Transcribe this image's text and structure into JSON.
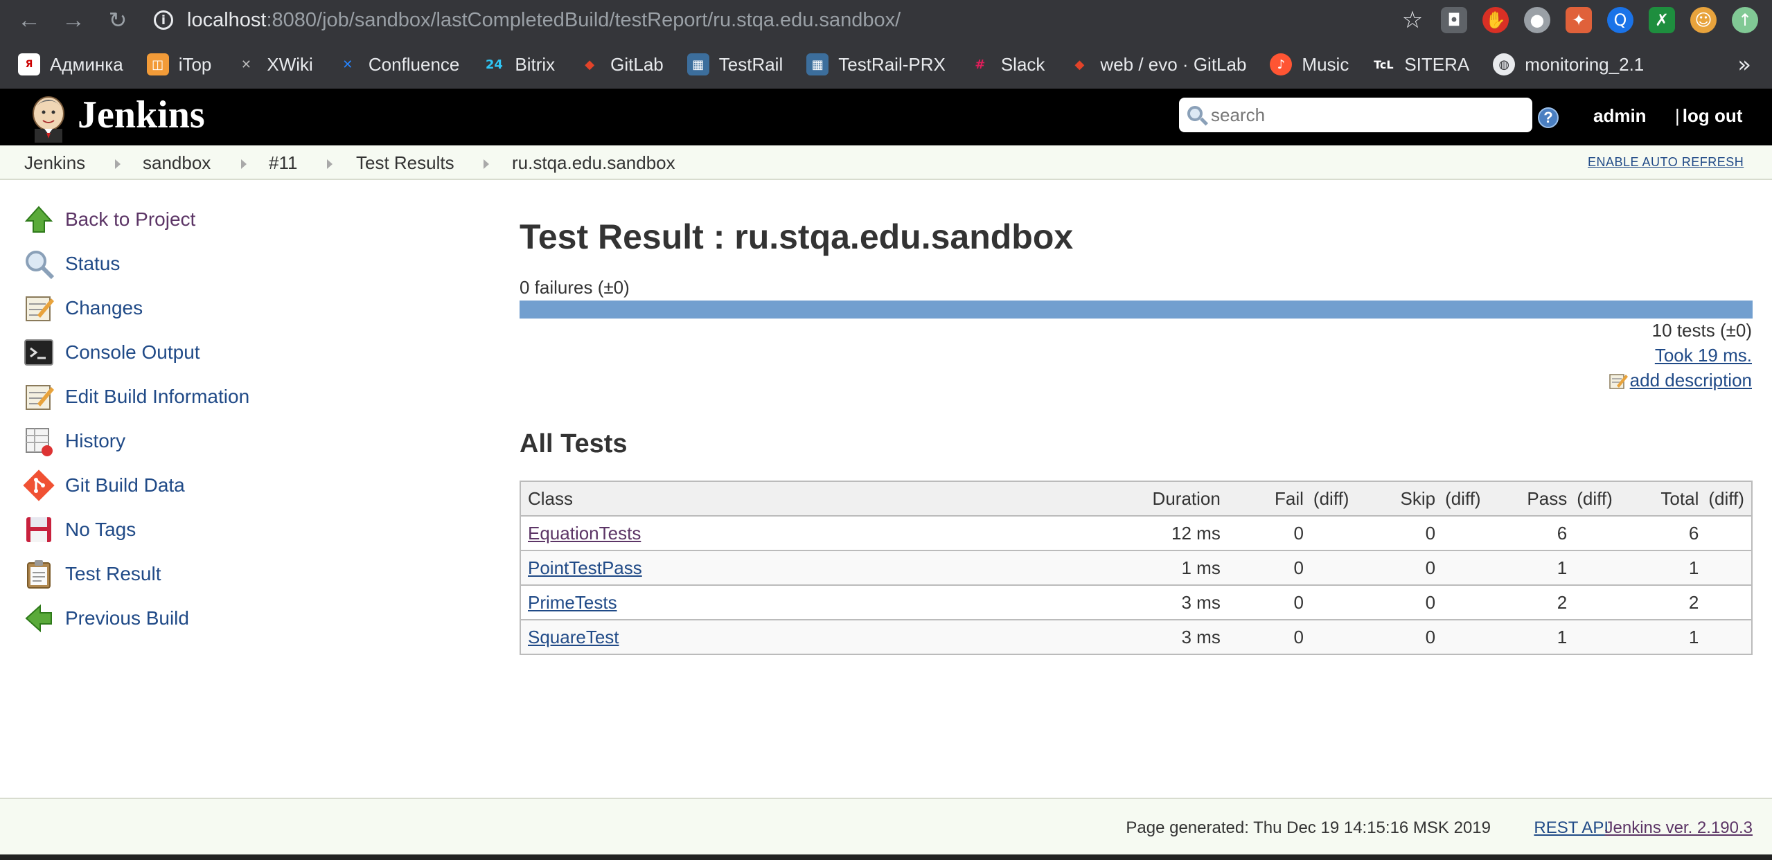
{
  "browser": {
    "url_host": "localhost",
    "url_rest": ":8080/job/sandbox/lastCompletedBuild/testReport/ru.stqa.edu.sandbox/",
    "bookmarks": [
      {
        "label": "Админка",
        "icon": "admin-bookmark-icon",
        "color": "#444444"
      },
      {
        "label": "iTop",
        "icon": "itop-icon",
        "color": "#f29b38"
      },
      {
        "label": "XWiki",
        "icon": "xwiki-icon",
        "color": "#666666"
      },
      {
        "label": "Confluence",
        "icon": "confluence-icon",
        "color": "#2684ff"
      },
      {
        "label": "Bitrix",
        "icon": "bitrix-icon",
        "color": "#2fc6f6"
      },
      {
        "label": "GitLab",
        "icon": "gitlab-icon",
        "color": "#e24329"
      },
      {
        "label": "TestRail",
        "icon": "testrail-icon",
        "color": "#3c6e9c"
      },
      {
        "label": "TestRail-PRX",
        "icon": "testrail-icon",
        "color": "#3c6e9c"
      },
      {
        "label": "Slack",
        "icon": "slack-icon",
        "color": "#4a154b"
      },
      {
        "label": "web / evo · GitLab",
        "icon": "gitlab-icon",
        "color": "#e24329"
      },
      {
        "label": "Music",
        "icon": "music-icon",
        "color": "#ff5533"
      },
      {
        "label": "SITERA",
        "icon": "sitera-icon",
        "color": "#222222"
      },
      {
        "label": "monitoring_2.1",
        "icon": "globe-icon",
        "color": "#888888"
      }
    ],
    "more": "»"
  },
  "header": {
    "title": "Jenkins",
    "search_placeholder": "search",
    "help": "?",
    "user": "admin",
    "logout": "log out"
  },
  "breadcrumbs": [
    "Jenkins",
    "sandbox",
    "#11",
    "Test Results",
    "ru.stqa.edu.sandbox"
  ],
  "auto_refresh": "ENABLE AUTO REFRESH",
  "side_panel": {
    "tasks": [
      {
        "label": "Back to Project",
        "icon": "up-arrow-icon"
      },
      {
        "label": "Status",
        "icon": "magnifier-icon"
      },
      {
        "label": "Changes",
        "icon": "notepad-icon"
      },
      {
        "label": "Console Output",
        "icon": "terminal-icon"
      },
      {
        "label": "Edit Build Information",
        "icon": "notepad-icon"
      },
      {
        "label": "History",
        "icon": "history-icon"
      },
      {
        "label": "Git Build Data",
        "icon": "git-icon"
      },
      {
        "label": "No Tags",
        "icon": "floppy-icon"
      },
      {
        "label": "Test Result",
        "icon": "clipboard-icon"
      },
      {
        "label": "Previous Build",
        "icon": "left-arrow-icon"
      }
    ]
  },
  "main": {
    "title": "Test Result : ru.stqa.edu.sandbox",
    "failures": "0 failures (±0)",
    "pass_fraction": 1.0,
    "tests_count": "10 tests (±0)",
    "took": "Took 19 ms.",
    "add_description": "add description",
    "all_tests_title": "All Tests",
    "table": {
      "headers": {
        "class": "Class",
        "duration": "Duration",
        "fail": "Fail",
        "skip": "Skip",
        "pass": "Pass",
        "total": "Total",
        "diff": "(diff)"
      },
      "rows": [
        {
          "class": "EquationTests",
          "duration": "12 ms",
          "fail": "0",
          "skip": "0",
          "pass": "6",
          "total": "6"
        },
        {
          "class": "PointTestPass",
          "duration": "1 ms",
          "fail": "0",
          "skip": "0",
          "pass": "1",
          "total": "1"
        },
        {
          "class": "PrimeTests",
          "duration": "3 ms",
          "fail": "0",
          "skip": "0",
          "pass": "2",
          "total": "2"
        },
        {
          "class": "SquareTest",
          "duration": "3 ms",
          "fail": "0",
          "skip": "0",
          "pass": "1",
          "total": "1"
        }
      ]
    }
  },
  "footer": {
    "generated": "Page generated: Thu Dec 19 14:15:16 MSK 2019",
    "rest_api": "REST API",
    "version": "Jenkins ver. 2.190.3"
  }
}
